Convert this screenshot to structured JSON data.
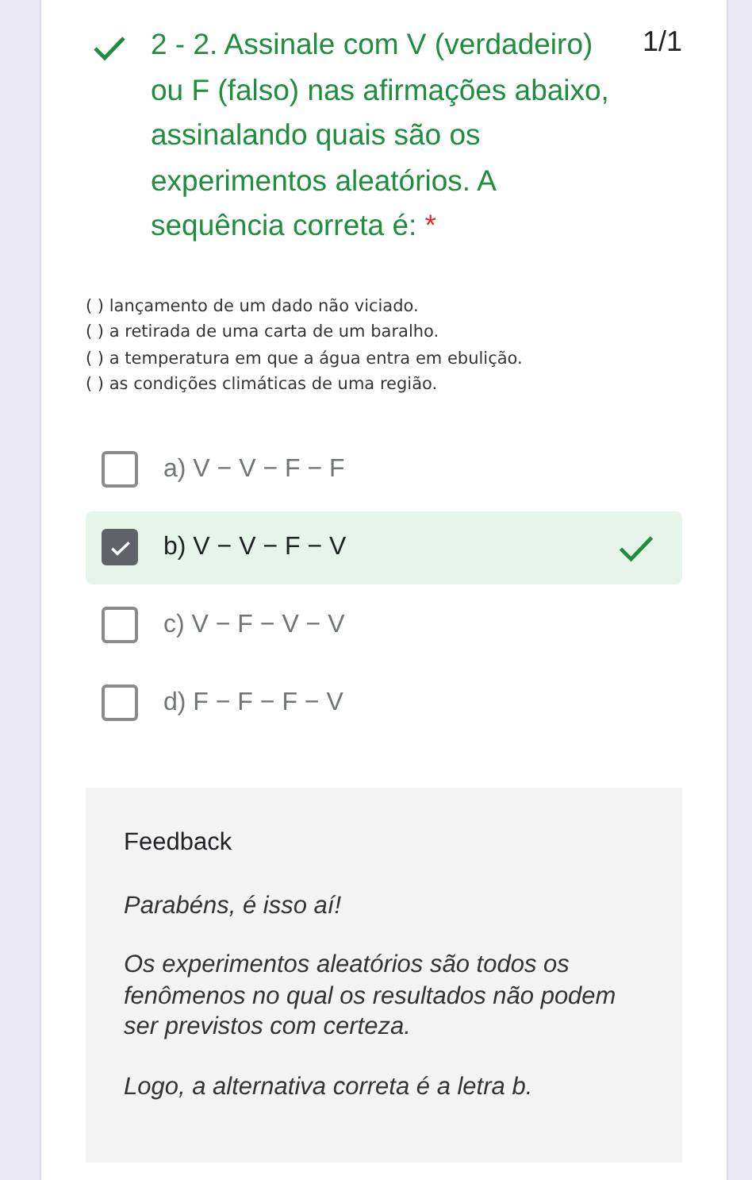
{
  "question": {
    "correct": true,
    "title": "2 - 2. Assinale com V (verdadeiro) ou F (falso) nas afirmações abaixo, assinalando quais são os experimentos aleatórios. A sequência correta é:",
    "required_mark": "*",
    "score": "1/1"
  },
  "statements": [
    "(   ) lançamento de um dado não viciado.",
    "(   ) a retirada de uma carta de um baralho.",
    "(   ) a temperatura em que a água entra em ebulição.",
    "(   ) as condições climáticas de uma região."
  ],
  "options": [
    {
      "label": "a) V − V − F − F",
      "selected": false,
      "correct": false
    },
    {
      "label": "b) V − V − F − V",
      "selected": true,
      "correct": true
    },
    {
      "label": "c) V − F − V − V",
      "selected": false,
      "correct": false
    },
    {
      "label": "d) F − F − F − V",
      "selected": false,
      "correct": false
    }
  ],
  "feedback": {
    "heading": "Feedback",
    "paragraphs": [
      "Parabéns, é isso aí!",
      "Os experimentos aleatórios são todos os fenômenos no qual os resultados não podem ser previstos com certeza.",
      "Logo, a alternativa correta é a letra b."
    ]
  }
}
